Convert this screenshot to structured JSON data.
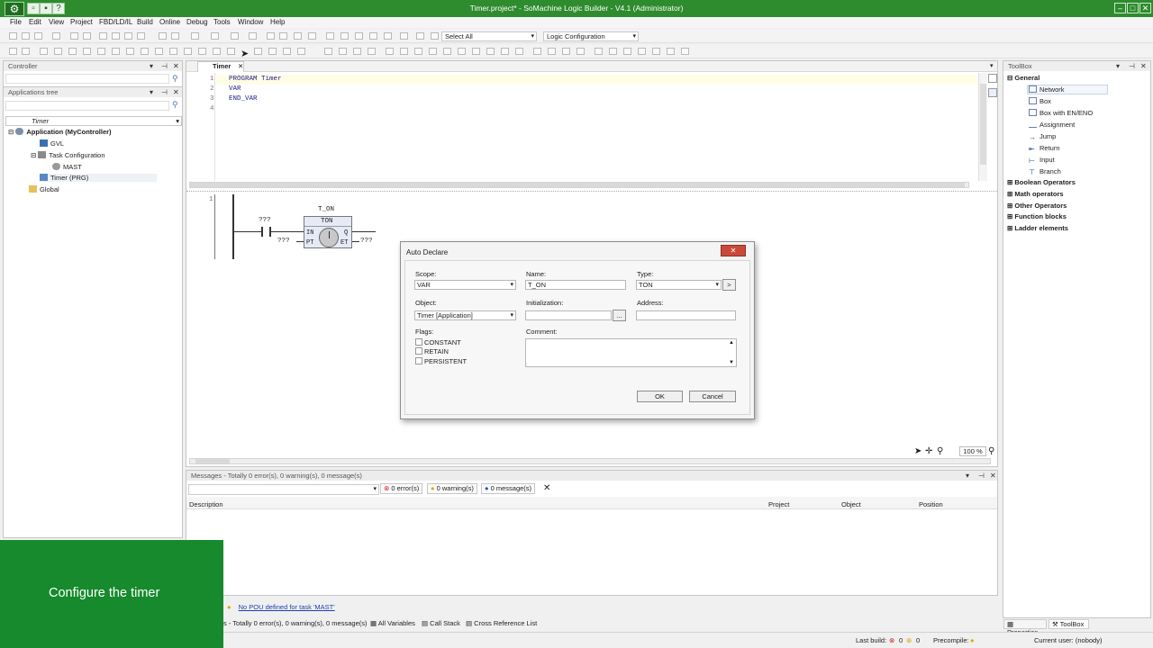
{
  "window": {
    "title": "Timer.project* - SoMachine Logic Builder - V4.1 (Administrator)"
  },
  "menu": [
    "File",
    "Edit",
    "View",
    "Project",
    "FBD/LD/IL",
    "Build",
    "Online",
    "Debug",
    "Tools",
    "Window",
    "Help"
  ],
  "toolbar": {
    "select_all": "Select All",
    "logic_config": "Logic Configuration"
  },
  "controller_panel": {
    "title": "Controller"
  },
  "app_tree": {
    "title": "Applications tree",
    "selector": "Timer",
    "items": [
      "Application (MyController)",
      "GVL",
      "Task Configuration",
      "MAST",
      "Timer (PRG)",
      "Global"
    ]
  },
  "editor": {
    "tab": "Timer",
    "gutter": [
      "1",
      "2",
      "3",
      "4"
    ],
    "lines": [
      "PROGRAM Timer",
      "VAR",
      "END_VAR",
      ""
    ],
    "network_number": "1",
    "block": {
      "instance": "T_ON",
      "type": "TON",
      "in": "IN",
      "pt": "PT",
      "q": "Q",
      "et": "ET",
      "contact_var": "???",
      "pt_var": "???",
      "et_var": "???"
    },
    "zoom": "100 %"
  },
  "dialog": {
    "title": "Auto Declare",
    "close": "✕",
    "scope_label": "Scope:",
    "scope_value": "VAR",
    "name_label": "Name:",
    "name_value": "T_ON",
    "type_label": "Type:",
    "type_value": "TON",
    "type_button": ">",
    "object_label": "Object:",
    "object_value": "Timer [Application]",
    "init_label": "Initialization:",
    "init_button": "...",
    "address_label": "Address:",
    "flags_label": "Flags:",
    "flags": [
      "CONSTANT",
      "RETAIN",
      "PERSISTENT"
    ],
    "comment_label": "Comment:",
    "ok": "OK",
    "cancel": "Cancel"
  },
  "messages": {
    "header": "Messages - Totally 0 error(s), 0 warning(s), 0 message(s)",
    "errors": "0 error(s)",
    "warnings": "0 warning(s)",
    "msgs": "0 message(s)",
    "columns": [
      "Description",
      "Project",
      "Object",
      "Position"
    ]
  },
  "toolbox": {
    "title": "ToolBox",
    "general": "General",
    "general_items": [
      "Network",
      "Box",
      "Box with EN/ENO",
      "Assignment",
      "Jump",
      "Return",
      "Input",
      "Branch"
    ],
    "groups": [
      "Boolean Operators",
      "Math operators",
      "Other Operators",
      "Function blocks",
      "Ladder elements"
    ],
    "tab_properties": "Properties",
    "tab_toolbox": "ToolBox"
  },
  "bottom": {
    "warning_link": "No POU defined for task 'MAST'",
    "summary": "s - Totally 0 error(s), 0 warning(s), 0 message(s)",
    "all_vars": "All Variables",
    "call_stack": "Call Stack",
    "cross_ref": "Cross Reference List"
  },
  "statusbar": {
    "last_build": "Last build:",
    "errors": "0",
    "warnings": "0",
    "precompile": "Precompile:",
    "user": "Current user: (nobody)"
  },
  "overlay": {
    "text": "Configure the timer"
  },
  "colors": {
    "accent": "#2e8b2e",
    "overlay": "#168a2c"
  }
}
